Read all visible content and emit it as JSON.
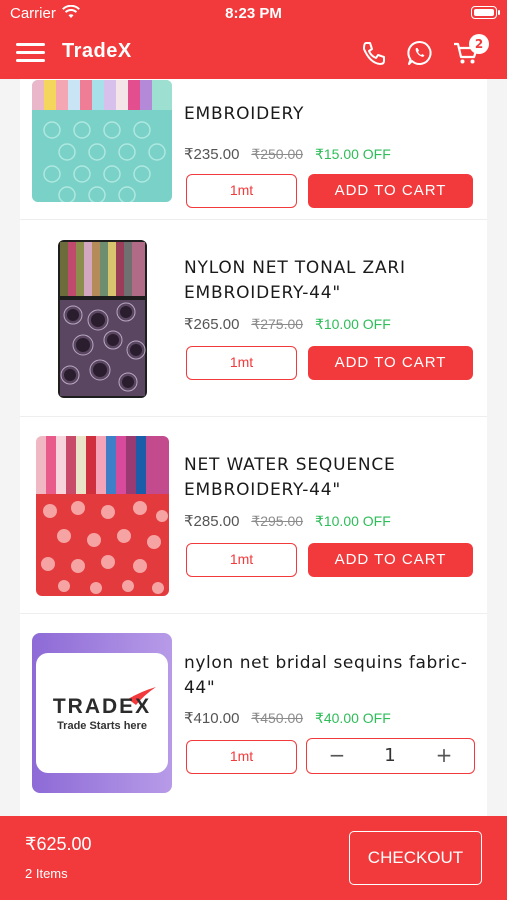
{
  "status_bar": {
    "carrier": "Carrier",
    "time": "8:23 PM",
    "wifi_icon": "wifi-icon",
    "battery_icon": "battery-icon"
  },
  "header": {
    "title": "TradeX",
    "menu_icon": "hamburger-menu-icon",
    "phone_icon": "phone-icon",
    "whatsapp_icon": "whatsapp-icon",
    "cart_icon": "cart-icon",
    "cart_count": "2",
    "accent": "#f23a3c"
  },
  "products": [
    {
      "name": "EMBROIDERY",
      "price": "₹235.00",
      "mrp": "₹250.00",
      "discount": "₹15.00 OFF",
      "unit": "1mt",
      "action": "ADD TO CART"
    },
    {
      "name": "NYLON NET TONAL ZARI EMBROIDERY-44\"",
      "price": "₹265.00",
      "mrp": "₹275.00",
      "discount": "₹10.00 OFF",
      "unit": "1mt",
      "action": "ADD TO CART"
    },
    {
      "name": "NET WATER SEQUENCE EMBROIDERY-44\"",
      "price": "₹285.00",
      "mrp": "₹295.00",
      "discount": "₹10.00 OFF",
      "unit": "1mt",
      "action": "ADD TO CART"
    },
    {
      "name": "nylon net bridal sequins fabric-44\"",
      "price": "₹410.00",
      "mrp": "₹450.00",
      "discount": "₹40.00 OFF",
      "unit": "1mt",
      "quantity": "1",
      "minus": "−",
      "plus": "+",
      "logo_brand": "TRADEX",
      "logo_tagline": "Trade Starts here"
    }
  ],
  "footer": {
    "total": "₹625.00",
    "items": "2 Items",
    "checkout": "CHECKOUT"
  },
  "colors": {
    "primary": "#f23a3c",
    "discount": "#2ebd59",
    "mrp": "#8c8c8c"
  }
}
